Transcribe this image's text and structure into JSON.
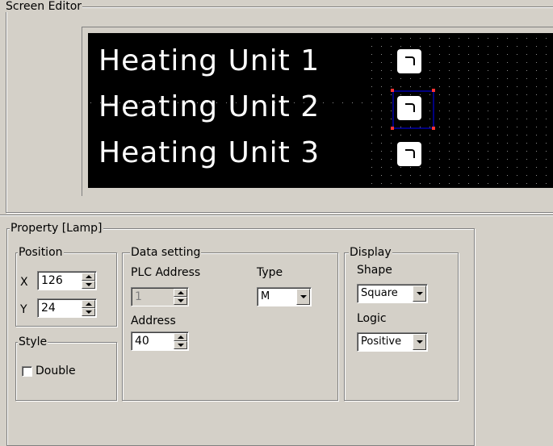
{
  "screen_editor": {
    "title": "Screen Editor",
    "lines": [
      "Heating Unit 1",
      "Heating Unit 2",
      "Heating Unit 3"
    ]
  },
  "property": {
    "title": "Property  [Lamp]",
    "position": {
      "title": "Position",
      "x_label": "X",
      "x_value": "126",
      "y_label": "Y",
      "y_value": "24"
    },
    "style": {
      "title": "Style",
      "double_label": "Double",
      "double_checked": false
    },
    "data_setting": {
      "title": "Data setting",
      "plc_address_label": "PLC Address",
      "plc_address_value": "1",
      "type_label": "Type",
      "type_value": "M",
      "address_label": "Address",
      "address_value": "40"
    },
    "display": {
      "title": "Display",
      "shape_label": "Shape",
      "shape_value": "Square",
      "logic_label": "Logic",
      "logic_value": "Positive"
    }
  },
  "colors": {
    "background": "#d4d0c8",
    "lcd_background": "#000000",
    "lcd_text": "#ffffff",
    "selection_border": "#000080",
    "selection_handles": "#ff3333"
  }
}
